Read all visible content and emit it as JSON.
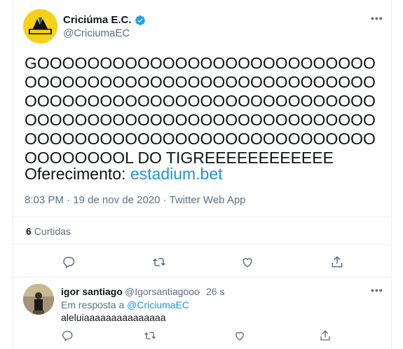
{
  "tweet": {
    "display_name": "Criciúma E.C.",
    "handle": "@CriciumaEC",
    "text": "GOOOOOOOOOOOOOOOOOOOOOOOOOOOOOOOOOOOOOOOOOOOOOOOOOOOOOOOOOOOOOOOOOOOOOOOOOOOOOOOOOOOOOOOOOOOOOOOOOOOOOOOOOOOOOOOOOOOOOOOOOOOOOOOOOOOOOOOOOOOOOOOOOOOL DO TIGREEEEEEEEEEEE",
    "offer_prefix": "Oferecimento: ",
    "offer_link": "estadium.bet",
    "time": "8:03 PM",
    "date": "19 de nov de 2020",
    "app": "Twitter Web App",
    "likes_count": "6",
    "likes_label": "Curtidas",
    "more_label": "•••"
  },
  "reply": {
    "display_name": "igor santiago",
    "handle": "@Igorsantiagooo",
    "time": "26 s",
    "in_reply_prefix": "Em resposta a ",
    "in_reply_handle": "@CriciumaEC",
    "text": "aleluiaaaaaaaaaaaaaaa",
    "more_label": "•••"
  },
  "separators": {
    "dot": "·"
  },
  "colors": {
    "link": "#1b95e0",
    "secondary_text": "#5b7083",
    "primary_text": "#0f1419",
    "verified": "#1da1f2",
    "brand_yellow": "#f7d117"
  },
  "icons": [
    "verified-badge-icon",
    "reply-icon",
    "retweet-icon",
    "like-icon",
    "share-icon",
    "more-icon"
  ]
}
